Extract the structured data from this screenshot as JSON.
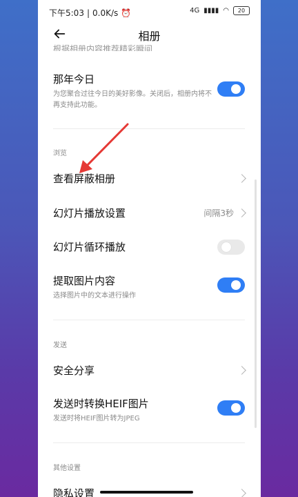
{
  "status": {
    "time": "下午5:03",
    "speed": "0.0K/s",
    "network": "4G",
    "battery": "20"
  },
  "header": {
    "title": "相册"
  },
  "clipped_text": "根据相册内容推荐精彩瞬间",
  "rows": {
    "memories": {
      "label": "那年今日",
      "description": "为您聚合过往今日的美好影像。关闭后，相册内将不再支持此功能。",
      "enabled": true
    },
    "browse_section": "浏览",
    "hidden_albums": {
      "label": "查看屏蔽相册"
    },
    "slideshow_settings": {
      "label": "幻灯片播放设置",
      "value": "间隔3秒"
    },
    "slideshow_loop": {
      "label": "幻灯片循环播放",
      "enabled": false
    },
    "extract_content": {
      "label": "提取图片内容",
      "description": "选择图片中的文本进行操作",
      "enabled": true
    },
    "send_section": "发送",
    "safe_share": {
      "label": "安全分享"
    },
    "convert_heif": {
      "label": "发送时转换HEIF图片",
      "description": "发送时将HEIF图片转为JPEG",
      "enabled": true
    },
    "other_section": "其他设置",
    "privacy": {
      "label": "隐私设置"
    }
  },
  "colors": {
    "accent": "#2f7ef5",
    "arrow": "#e53935"
  }
}
